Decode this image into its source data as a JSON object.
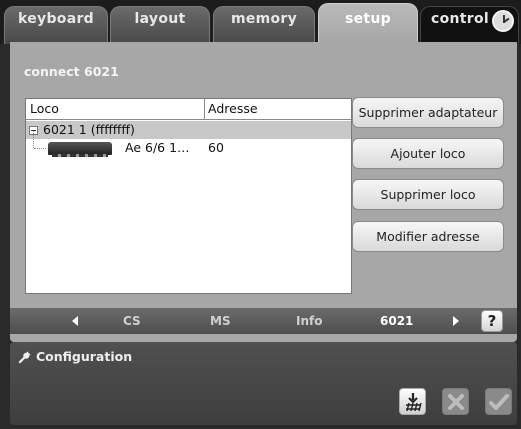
{
  "tabs": [
    {
      "label": "keyboard",
      "state": "inactive"
    },
    {
      "label": "layout",
      "state": "inactive"
    },
    {
      "label": "memory",
      "state": "inactive"
    },
    {
      "label": "setup",
      "state": "active"
    },
    {
      "label": "control",
      "state": "inactive",
      "icon": "clock-icon"
    }
  ],
  "panel": {
    "title": "connect 6021",
    "list": {
      "columns": [
        "Loco",
        "Adresse"
      ],
      "tree": {
        "parent_label": "6021 1 (ffffffff)",
        "child": {
          "icon": "locomotive-icon",
          "name": "Ae 6/6 1…",
          "address": "60"
        }
      }
    },
    "buttons": [
      "Supprimer adaptateur",
      "Ajouter loco",
      "Supprimer loco",
      "Modifier adresse"
    ]
  },
  "nav": {
    "items": [
      "CS",
      "MS",
      "Info",
      "6021"
    ],
    "current": "6021",
    "help_label": "?"
  },
  "config": {
    "title": "Configuration",
    "icon": "wrench-icon",
    "actions": [
      {
        "name": "track-download",
        "enabled": true
      },
      {
        "name": "cancel",
        "enabled": false
      },
      {
        "name": "confirm",
        "enabled": false
      }
    ]
  },
  "colors": {
    "panel_bg": "#a7a7a7",
    "tab_active": "#b0b0b0",
    "selected_row": "#c8c8c8",
    "dark_bg": "#2a2a2a"
  }
}
